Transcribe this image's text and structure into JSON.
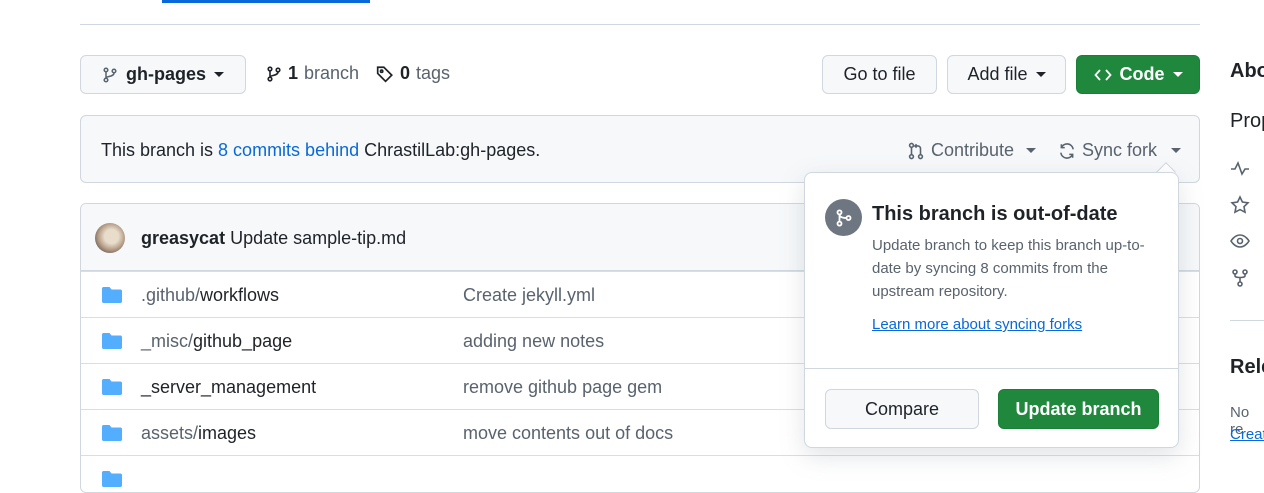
{
  "toolbar": {
    "branch_name": "gh-pages",
    "branch_count": "1",
    "branch_label": "branch",
    "tag_count": "0",
    "tag_label": "tags",
    "go_to_file": "Go to file",
    "add_file": "Add file",
    "code": "Code"
  },
  "sidebar": {
    "about_heading": "Abo",
    "description": "Prop",
    "releases_heading": "Rele",
    "no_releases": "No re",
    "create_link": "Creat"
  },
  "banner": {
    "prefix": "This branch is ",
    "commits_behind": "8 commits behind",
    "upstream": " ChrastilLab:gh-pages.",
    "contribute": "Contribute",
    "sync_fork": "Sync fork"
  },
  "latest_commit": {
    "author": "greasycat",
    "message": "Update sample-tip.md"
  },
  "files": [
    {
      "dir": ".github/",
      "name": "workflows",
      "message": "Create jekyll.yml"
    },
    {
      "dir": "_misc/",
      "name": "github_page",
      "message": "adding new notes"
    },
    {
      "dir": "",
      "name": "_server_management",
      "message": "remove github page gem"
    },
    {
      "dir": "assets/",
      "name": "images",
      "message": "move contents out of docs"
    }
  ],
  "popover": {
    "title": "This branch is out-of-date",
    "body": "Update branch to keep this branch up-to-date by syncing 8 commits from the upstream repository.",
    "learn_more": "Learn more about syncing forks",
    "compare": "Compare",
    "update_branch": "Update branch"
  },
  "colors": {
    "primary_green": "#1f883d",
    "link_blue": "#0969da",
    "folder_blue": "#54aeff",
    "muted_text": "#59636e"
  }
}
